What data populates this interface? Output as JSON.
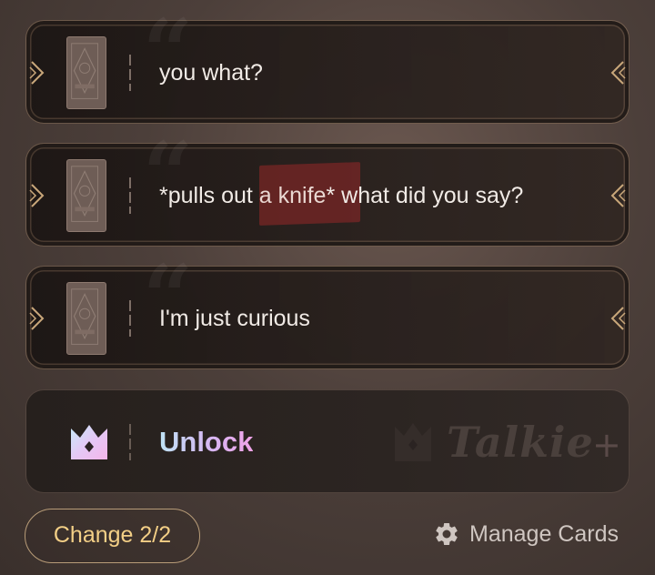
{
  "cards": [
    {
      "text_before": "you what?",
      "highlight": "",
      "text_after": ""
    },
    {
      "text_before": "*pulls out ",
      "highlight": "a knife",
      "text_after": "* what did you say?"
    },
    {
      "text_before": "I'm just curious",
      "highlight": "",
      "text_after": ""
    }
  ],
  "unlock": {
    "label": "Unlock",
    "brand": "Talkie",
    "brand_suffix": "+"
  },
  "footer": {
    "change_label": "Change 2/2",
    "manage_label": "Manage Cards"
  },
  "colors": {
    "accent_gold": "#f3cf86",
    "card_border": "#b89c78",
    "redaction": "#962828"
  }
}
